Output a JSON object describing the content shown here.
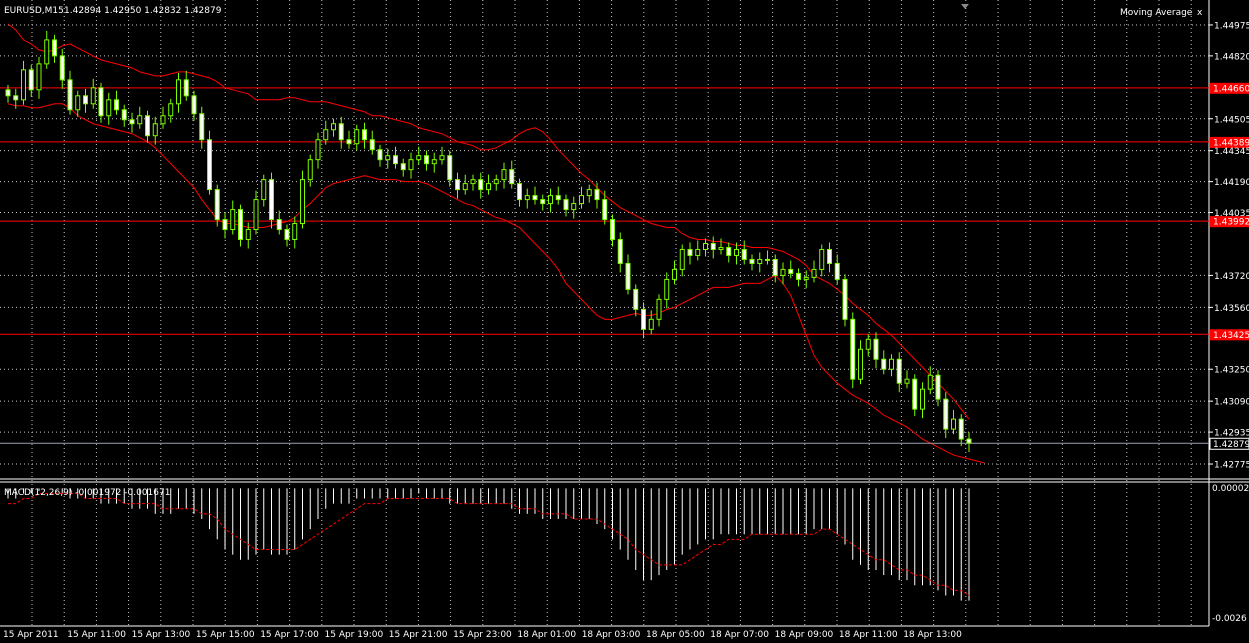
{
  "header": {
    "symbol": "EURUSD,M15",
    "ohlc": "1.42894 1.42950 1.42832 1.42879"
  },
  "indicator_panel": {
    "label": "Moving Average",
    "close_glyph": "x"
  },
  "macd": {
    "label": "MACD(12,26,9) -0.001972 -0.001671",
    "axis_top": "0.000026",
    "axis_bottom": "-0.0026"
  },
  "price_axis": [
    "1.44975",
    "1.44820",
    "1.44505",
    "1.44345",
    "1.44190",
    "1.44035",
    "1.43720",
    "1.43560",
    "1.43250",
    "1.43090",
    "1.42935",
    "1.42775"
  ],
  "time_axis": [
    "15 Apr 2011",
    "15 Apr 11:00",
    "15 Apr 13:00",
    "15 Apr 15:00",
    "15 Apr 17:00",
    "15 Apr 19:00",
    "15 Apr 21:00",
    "15 Apr 23:00",
    "18 Apr 01:00",
    "18 Apr 03:00",
    "18 Apr 05:00",
    "18 Apr 07:00",
    "18 Apr 09:00",
    "18 Apr 11:00",
    "18 Apr 13:00"
  ],
  "levels": [
    {
      "value": 1.4466,
      "label": "1.44660"
    },
    {
      "value": 1.44389,
      "label": "1.44389"
    },
    {
      "value": 1.43992,
      "label": "1.43992"
    },
    {
      "value": 1.43425,
      "label": "1.43425"
    }
  ],
  "current_price": {
    "value": 1.42879,
    "label": "1.42879"
  },
  "colors": {
    "background": "#000000",
    "grid": "#c8c8c8",
    "candle": "#7cfc00",
    "candle_body": "#ffffff",
    "bands": "#ff0000",
    "level_line": "#ff0000",
    "macd_hist": "#ffffff",
    "macd_signal": "#ff0000"
  },
  "chart_data": {
    "type": "candlestick",
    "y_range": [
      1.427,
      1.451
    ],
    "x_labels": [
      "15 Apr 2011",
      "15 Apr 11:00",
      "15 Apr 13:00",
      "15 Apr 15:00",
      "15 Apr 17:00",
      "15 Apr 19:00",
      "15 Apr 21:00",
      "15 Apr 23:00",
      "18 Apr 01:00",
      "18 Apr 03:00",
      "18 Apr 05:00",
      "18 Apr 07:00",
      "18 Apr 09:00",
      "18 Apr 11:00",
      "18 Apr 13:00"
    ],
    "close": [
      1.4462,
      1.446,
      1.4475,
      1.4465,
      1.4478,
      1.449,
      1.4482,
      1.447,
      1.4455,
      1.4462,
      1.4458,
      1.4466,
      1.4452,
      1.446,
      1.4455,
      1.445,
      1.4448,
      1.4452,
      1.4442,
      1.4448,
      1.4452,
      1.4458,
      1.447,
      1.4462,
      1.4453,
      1.444,
      1.4415,
      1.44,
      1.4395,
      1.4405,
      1.439,
      1.4395,
      1.441,
      1.442,
      1.44,
      1.4395,
      1.439,
      1.4398,
      1.442,
      1.443,
      1.444,
      1.4445,
      1.4448,
      1.444,
      1.4438,
      1.4445,
      1.444,
      1.4435,
      1.443,
      1.4432,
      1.4428,
      1.4425,
      1.443,
      1.4432,
      1.4428,
      1.443,
      1.4432,
      1.442,
      1.4415,
      1.4418,
      1.442,
      1.4415,
      1.4418,
      1.442,
      1.4425,
      1.4418,
      1.441,
      1.4412,
      1.441,
      1.4408,
      1.4412,
      1.441,
      1.4405,
      1.4408,
      1.4412,
      1.4415,
      1.441,
      1.44,
      1.439,
      1.4378,
      1.4365,
      1.4355,
      1.4345,
      1.435,
      1.436,
      1.437,
      1.4375,
      1.4385,
      1.4382,
      1.4385,
      1.4388,
      1.4385,
      1.4386,
      1.4382,
      1.4385,
      1.438,
      1.4378,
      1.438,
      1.438,
      1.4372,
      1.4375,
      1.4373,
      1.437,
      1.4371,
      1.4375,
      1.4385,
      1.4378,
      1.437,
      1.435,
      1.432,
      1.4335,
      1.434,
      1.433,
      1.4325,
      1.433,
      1.4318,
      1.432,
      1.4305,
      1.4315,
      1.4322,
      1.431,
      1.4295,
      1.43,
      1.429,
      1.4288
    ],
    "bands": {
      "upper": [
        1.4498,
        1.4495,
        1.449,
        1.4488,
        1.4485,
        1.4484,
        1.4485,
        1.4487,
        1.4488,
        1.4486,
        1.4484,
        1.4482,
        1.448,
        1.4479,
        1.4478,
        1.4477,
        1.4476,
        1.4474,
        1.4473,
        1.4472,
        1.4472,
        1.4473,
        1.4474,
        1.4474,
        1.4473,
        1.4472,
        1.4471,
        1.4469,
        1.4466,
        1.4465,
        1.4464,
        1.4463,
        1.446,
        1.446,
        1.446,
        1.446,
        1.4461,
        1.4461,
        1.446,
        1.4459,
        1.4459,
        1.4459,
        1.4458,
        1.4457,
        1.4456,
        1.4455,
        1.4454,
        1.4452,
        1.4452,
        1.4451,
        1.445,
        1.4449,
        1.4448,
        1.4446,
        1.4445,
        1.4444,
        1.4443,
        1.4441,
        1.4439,
        1.4438,
        1.4437,
        1.4435,
        1.4435,
        1.4436,
        1.4438,
        1.444,
        1.4443,
        1.4445,
        1.4446,
        1.4444,
        1.444,
        1.4435,
        1.4431,
        1.4427,
        1.4423,
        1.442,
        1.4416,
        1.4412,
        1.4409,
        1.4406,
        1.4404,
        1.4402,
        1.44,
        1.4398,
        1.4397,
        1.4396,
        1.4396,
        1.4393,
        1.4391,
        1.439,
        1.439,
        1.4389,
        1.4389,
        1.4388,
        1.4387,
        1.4387,
        1.4386,
        1.4386,
        1.4386,
        1.4385,
        1.4384,
        1.4382,
        1.438,
        1.4377,
        1.4372,
        1.437,
        1.4368,
        1.4365,
        1.4362,
        1.4358,
        1.4355,
        1.4352,
        1.4348,
        1.4345,
        1.4342,
        1.4338,
        1.4334,
        1.433,
        1.4326,
        1.4322,
        1.4318,
        1.4314,
        1.431,
        1.4305,
        1.43
      ],
      "lower": [
        1.4458,
        1.4457,
        1.4457,
        1.4456,
        1.4456,
        1.4457,
        1.4458,
        1.4458,
        1.4456,
        1.4452,
        1.445,
        1.4448,
        1.4447,
        1.4446,
        1.4445,
        1.4444,
        1.4443,
        1.4441,
        1.4439,
        1.4436,
        1.4432,
        1.4428,
        1.4424,
        1.442,
        1.4416,
        1.441,
        1.4405,
        1.44,
        1.4398,
        1.4398,
        1.4397,
        1.4396,
        1.4396,
        1.4396,
        1.4397,
        1.4398,
        1.4399,
        1.4401,
        1.4405,
        1.4408,
        1.4412,
        1.4416,
        1.4418,
        1.4419,
        1.442,
        1.4421,
        1.4422,
        1.4421,
        1.442,
        1.442,
        1.442,
        1.4419,
        1.4419,
        1.4419,
        1.4418,
        1.4416,
        1.4414,
        1.4412,
        1.441,
        1.4408,
        1.4407,
        1.4405,
        1.4403,
        1.4401,
        1.44,
        1.4398,
        1.4396,
        1.4392,
        1.4388,
        1.4384,
        1.438,
        1.4375,
        1.4368,
        1.4364,
        1.436,
        1.4356,
        1.4352,
        1.435,
        1.435,
        1.4351,
        1.4352,
        1.4353,
        1.4352,
        1.4352,
        1.4353,
        1.4355,
        1.4356,
        1.4358,
        1.436,
        1.4362,
        1.4364,
        1.4366,
        1.4366,
        1.4366,
        1.4367,
        1.4368,
        1.4368,
        1.4368,
        1.437,
        1.4372,
        1.4368,
        1.4362,
        1.4352,
        1.4342,
        1.4332,
        1.4326,
        1.4322,
        1.4318,
        1.4315,
        1.4312,
        1.431,
        1.4308,
        1.4305,
        1.4302,
        1.43,
        1.4298,
        1.4296,
        1.4293,
        1.429,
        1.4288,
        1.4286,
        1.4284,
        1.4282,
        1.4281,
        1.428,
        1.4279,
        1.4278
      ]
    },
    "macd": {
      "range": [
        -0.0026,
        2.6e-05
      ],
      "hist": [
        -0.0002,
        -0.0002,
        -0.0001,
        -0.0001,
        -5e-05,
        0.0,
        0.0,
        -0.0001,
        -0.0002,
        -0.0002,
        -0.0002,
        -0.0002,
        -0.0003,
        -0.0003,
        -0.0003,
        -0.0003,
        -0.0004,
        -0.0004,
        -0.0004,
        -0.0005,
        -0.0005,
        -0.0005,
        -0.0004,
        -0.0004,
        -0.0005,
        -0.0006,
        -0.0008,
        -0.001,
        -0.0012,
        -0.0013,
        -0.0014,
        -0.0014,
        -0.0013,
        -0.0012,
        -0.0013,
        -0.0013,
        -0.0013,
        -0.0012,
        -0.001,
        -0.0008,
        -0.0006,
        -0.0004,
        -0.0003,
        -0.0003,
        -0.0003,
        -0.0002,
        -0.0002,
        -0.0002,
        -0.0002,
        -0.0002,
        -0.0002,
        -0.0002,
        -0.0002,
        -0.0001,
        -0.0002,
        -0.0002,
        -0.0002,
        -0.0003,
        -0.0003,
        -0.0003,
        -0.0003,
        -0.0003,
        -0.0003,
        -0.0003,
        -0.0003,
        -0.0004,
        -0.0005,
        -0.0005,
        -0.0005,
        -0.0006,
        -0.0006,
        -0.0006,
        -0.0006,
        -0.0006,
        -0.0006,
        -0.0006,
        -0.0007,
        -0.0008,
        -0.001,
        -0.0012,
        -0.0014,
        -0.0016,
        -0.0018,
        -0.0018,
        -0.0017,
        -0.0016,
        -0.0015,
        -0.0013,
        -0.0012,
        -0.0011,
        -0.001,
        -0.001,
        -0.0009,
        -0.0009,
        -0.0009,
        -0.0009,
        -0.0009,
        -0.0009,
        -0.0009,
        -0.0009,
        -0.0009,
        -0.0009,
        -0.0009,
        -0.0009,
        -0.0008,
        -0.0008,
        -0.0008,
        -0.0009,
        -0.0011,
        -0.0014,
        -0.0015,
        -0.0016,
        -0.0016,
        -0.0017,
        -0.0017,
        -0.0018,
        -0.0018,
        -0.0019,
        -0.0019,
        -0.0019,
        -0.002,
        -0.0021,
        -0.0021,
        -0.0022,
        -0.0022
      ],
      "signal": [
        -0.0003,
        -0.0003,
        -0.0002,
        -0.0002,
        -0.0001,
        -0.0001,
        -0.0001,
        -0.0001,
        -0.0001,
        -0.0001,
        -0.0002,
        -0.0002,
        -0.0002,
        -0.0002,
        -0.0002,
        -0.0003,
        -0.0003,
        -0.0003,
        -0.0003,
        -0.0003,
        -0.0004,
        -0.0004,
        -0.0004,
        -0.0004,
        -0.0004,
        -0.0005,
        -0.0005,
        -0.0006,
        -0.0008,
        -0.0009,
        -0.001,
        -0.0011,
        -0.0012,
        -0.0012,
        -0.0012,
        -0.0012,
        -0.0012,
        -0.0012,
        -0.0011,
        -0.001,
        -0.0009,
        -0.0008,
        -0.0007,
        -0.0006,
        -0.0005,
        -0.0004,
        -0.0003,
        -0.0003,
        -0.0003,
        -0.0002,
        -0.0002,
        -0.0002,
        -0.0002,
        -0.0002,
        -0.0002,
        -0.0002,
        -0.0002,
        -0.0002,
        -0.0003,
        -0.0003,
        -0.0003,
        -0.0003,
        -0.0003,
        -0.0003,
        -0.0003,
        -0.0003,
        -0.0004,
        -0.0004,
        -0.0004,
        -0.0005,
        -0.0005,
        -0.0005,
        -0.0005,
        -0.0006,
        -0.0006,
        -0.0006,
        -0.0006,
        -0.0007,
        -0.0008,
        -0.0009,
        -0.001,
        -0.0012,
        -0.0013,
        -0.0014,
        -0.0015,
        -0.0015,
        -0.0015,
        -0.0015,
        -0.0014,
        -0.0013,
        -0.0012,
        -0.0011,
        -0.0011,
        -0.001,
        -0.001,
        -0.001,
        -0.0009,
        -0.0009,
        -0.0009,
        -0.0009,
        -0.0009,
        -0.0009,
        -0.0009,
        -0.0009,
        -0.0009,
        -0.0008,
        -0.0008,
        -0.0009,
        -0.001,
        -0.0011,
        -0.0012,
        -0.0013,
        -0.0014,
        -0.0014,
        -0.0015,
        -0.0016,
        -0.0016,
        -0.0017,
        -0.0017,
        -0.0018,
        -0.0019,
        -0.0019,
        -0.002,
        -0.002,
        -0.0021
      ]
    }
  }
}
